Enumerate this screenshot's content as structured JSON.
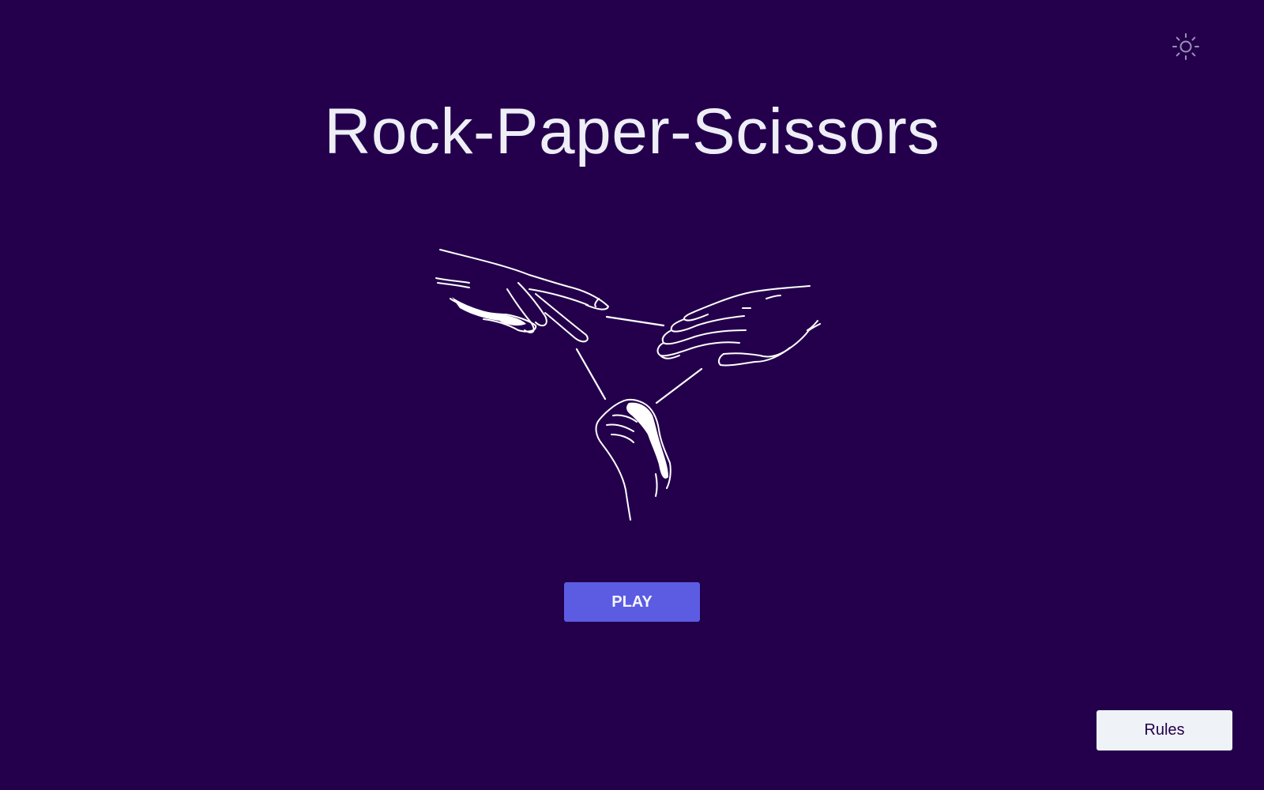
{
  "app": {
    "title": "Rock-Paper-Scissors"
  },
  "header": {
    "theme_toggle_icon": "sun-icon"
  },
  "hero": {
    "illustration_icons": [
      "scissors-hand-icon",
      "paper-hand-icon",
      "rock-fist-icon"
    ]
  },
  "actions": {
    "play_label": "PLAY",
    "rules_label": "Rules"
  },
  "colors": {
    "background": "#24004c",
    "accent": "#5b5ce2",
    "text": "#eeeef6",
    "secondary_button": "#eff2f6"
  }
}
